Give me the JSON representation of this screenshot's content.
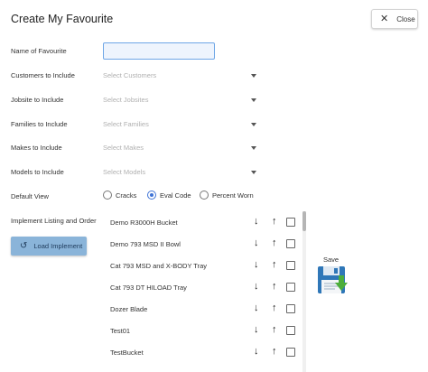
{
  "dialog": {
    "title": "Create My Favourite",
    "close_label": "Close"
  },
  "form": {
    "name_label": "Name of Favourite",
    "name_value": "",
    "customers": {
      "label": "Customers to Include",
      "placeholder": "Select Customers"
    },
    "jobsites": {
      "label": "Jobsite to Include",
      "placeholder": "Select Jobsites"
    },
    "families": {
      "label": "Families to Include",
      "placeholder": "Select Families"
    },
    "makes": {
      "label": "Makes to Include",
      "placeholder": "Select Makes"
    },
    "models": {
      "label": "Models to Include",
      "placeholder": "Select Models"
    },
    "default_view": {
      "label": "Default View",
      "options": [
        "Cracks",
        "Eval Code",
        "Percent Worn"
      ],
      "selected": "Eval Code"
    },
    "implement_label": "Implement Listing and Order",
    "load_label": "Load Implement"
  },
  "implements": [
    "Demo R3000H Bucket",
    "Demo 793 MSD II Bowl",
    "Cat 793 MSD and X-BODY Tray",
    "Cat 793 DT HILOAD Tray",
    "Dozer Blade",
    "Test01",
    "TestBucket"
  ],
  "save_label": "Save",
  "icons": {
    "close": "x-icon",
    "load": "undo-icon",
    "move_down": "arrow-down-icon",
    "move_up": "arrow-up-icon",
    "save": "floppy-disk-icon"
  },
  "colors": {
    "accent": "#3f73d6",
    "load_button": "#8ab4d9",
    "input_focus_border": "#6ea6e6"
  }
}
